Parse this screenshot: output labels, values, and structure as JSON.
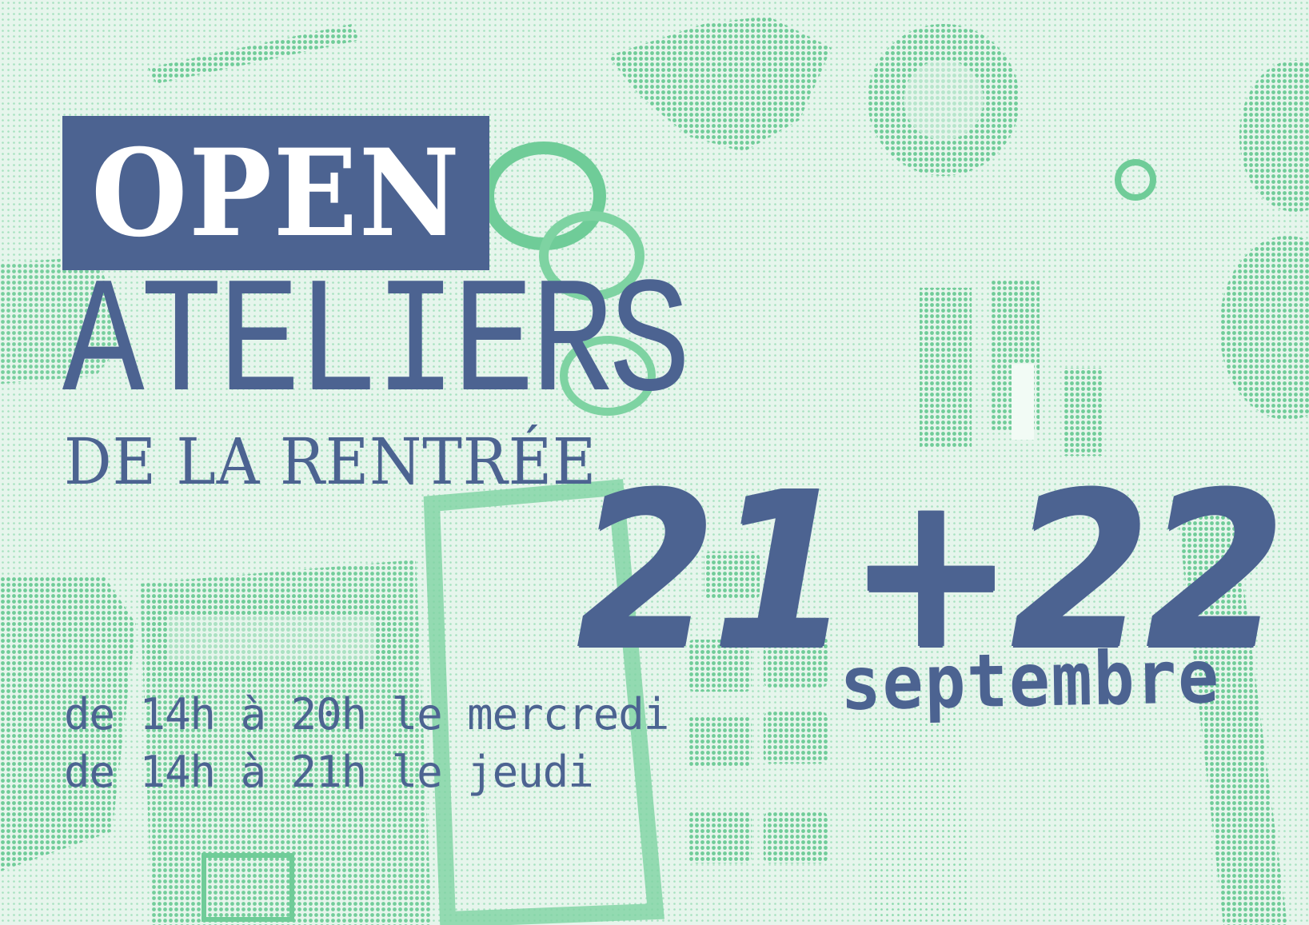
{
  "poster": {
    "headline": "OPEN",
    "title": "ATELIERS",
    "subtitle": "DE LA RENTRÉE",
    "dates": "21+22",
    "month": "septembre",
    "hours": [
      "de 14h à 20h le mercredi",
      "de 14h à 21h le jeudi"
    ]
  },
  "colors": {
    "background": "#e6f5ec",
    "halftone_green": "#7ed3a2",
    "ink_blue": "#4c6391",
    "white": "#ffffff"
  }
}
